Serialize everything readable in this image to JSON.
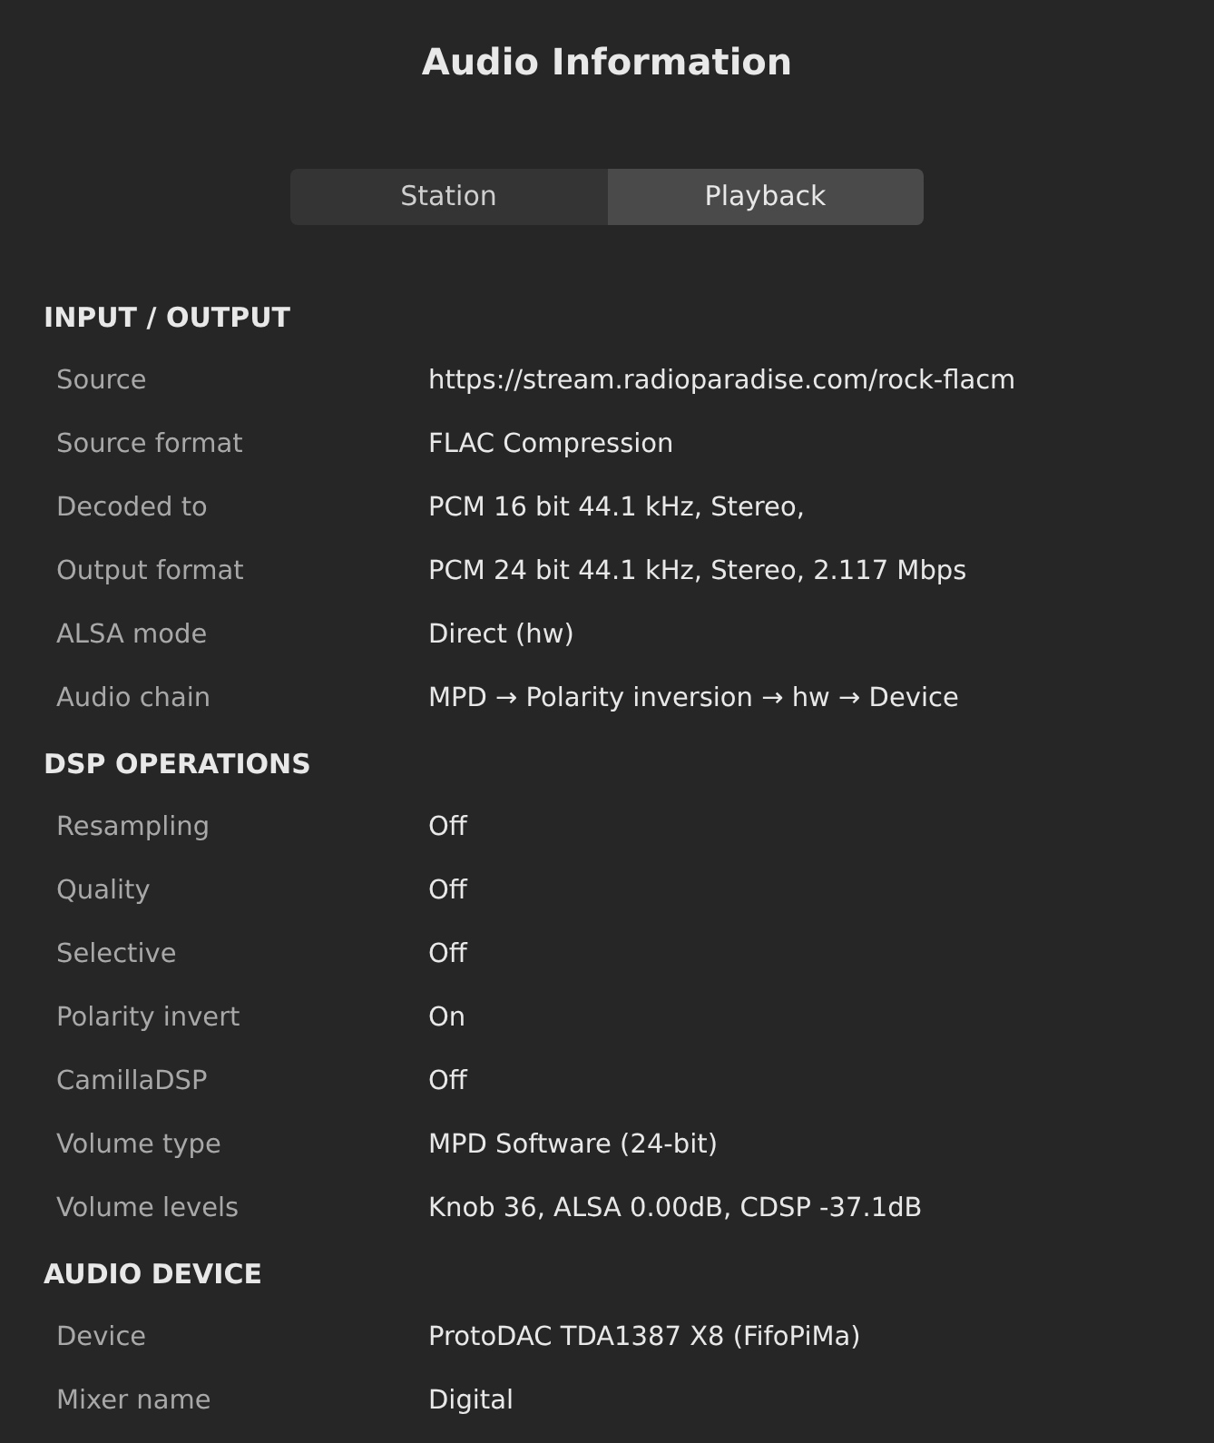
{
  "title": "Audio Information",
  "tabs": [
    {
      "label": "Station",
      "selected": false
    },
    {
      "label": "Playback",
      "selected": true
    }
  ],
  "sections": [
    {
      "heading": "INPUT / OUTPUT",
      "rows": [
        {
          "label": "Source",
          "value": "https://stream.radioparadise.com/rock-flacm"
        },
        {
          "label": "Source format",
          "value": "FLAC Compression"
        },
        {
          "label": "Decoded to",
          "value": "PCM 16 bit 44.1 kHz, Stereo,"
        },
        {
          "label": "Output format",
          "value": "PCM 24 bit 44.1 kHz, Stereo, 2.117 Mbps"
        },
        {
          "label": "ALSA mode",
          "value": "Direct (hw)"
        },
        {
          "label": "Audio chain",
          "value": "MPD → Polarity inversion → hw → Device"
        }
      ]
    },
    {
      "heading": "DSP OPERATIONS",
      "rows": [
        {
          "label": "Resampling",
          "value": "Off"
        },
        {
          "label": "Quality",
          "value": "Off"
        },
        {
          "label": "Selective",
          "value": "Off"
        },
        {
          "label": "Polarity invert",
          "value": "On"
        },
        {
          "label": "CamillaDSP",
          "value": "Off"
        },
        {
          "label": "Volume type",
          "value": "MPD Software (24-bit)"
        },
        {
          "label": "Volume levels",
          "value": "Knob 36, ALSA 0.00dB, CDSP -37.1dB"
        }
      ]
    },
    {
      "heading": "AUDIO DEVICE",
      "rows": [
        {
          "label": "Device",
          "value": "ProtoDAC TDA1387 X8 (FifoPiMa)"
        },
        {
          "label": "Mixer name",
          "value": "Digital"
        }
      ]
    }
  ]
}
